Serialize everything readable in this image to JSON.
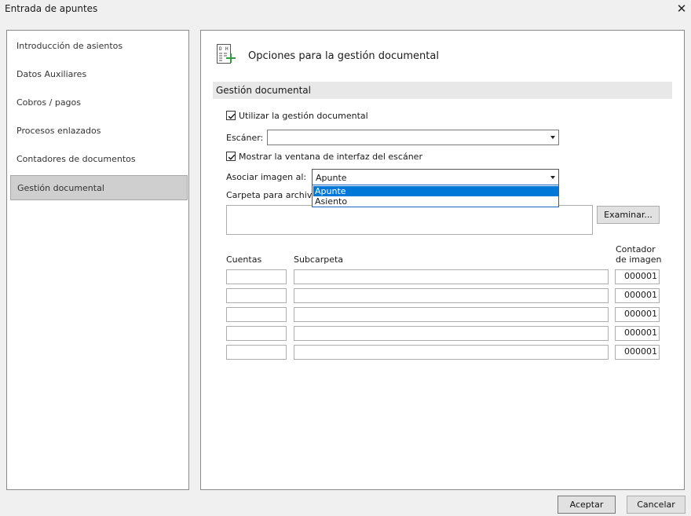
{
  "window": {
    "title": "Entrada de apuntes",
    "close_glyph": "✕"
  },
  "sidebar": {
    "items": [
      {
        "label": "Introducción de asientos"
      },
      {
        "label": "Datos Auxiliares"
      },
      {
        "label": "Cobros / pagos"
      },
      {
        "label": "Procesos enlazados"
      },
      {
        "label": "Contadores de documentos"
      },
      {
        "label": "Gestión documental",
        "selected": true
      }
    ]
  },
  "header": {
    "title": "Opciones para la gestión documental",
    "icon": "document-add-icon",
    "icon_letters": [
      "D",
      "H"
    ],
    "icon_accent": "#2e9e3e"
  },
  "section": {
    "title": "Gestión documental"
  },
  "form": {
    "use_docmgmt": {
      "label": "Utilizar la gestión documental",
      "checked": true
    },
    "scanner": {
      "label": "Escáner:",
      "value": ""
    },
    "show_scanner_ui": {
      "label": "Mostrar la ventana de interfaz del escáner",
      "checked": true
    },
    "associate": {
      "label": "Asociar imagen al:",
      "value": "Apunte",
      "options": [
        {
          "label": "Apunte",
          "highlighted": true
        },
        {
          "label": "Asiento",
          "highlighted": false
        }
      ]
    },
    "folder": {
      "label": "Carpeta para archivo:",
      "value": ""
    },
    "browse_label": "Examinar..."
  },
  "table": {
    "headers": {
      "accounts": "Cuentas",
      "subfolder": "Subcarpeta",
      "counter_line1": "Contador",
      "counter_line2": "de imagen"
    },
    "rows": [
      {
        "account": "",
        "subfolder": "",
        "counter": "000001"
      },
      {
        "account": "",
        "subfolder": "",
        "counter": "000001"
      },
      {
        "account": "",
        "subfolder": "",
        "counter": "000001"
      },
      {
        "account": "",
        "subfolder": "",
        "counter": "000001"
      },
      {
        "account": "",
        "subfolder": "",
        "counter": "000001"
      }
    ]
  },
  "footer": {
    "accept_label": "Aceptar",
    "cancel_label": "Cancelar"
  },
  "colors": {
    "highlight": "#0078d7",
    "selected_nav": "#cfcfcf"
  }
}
